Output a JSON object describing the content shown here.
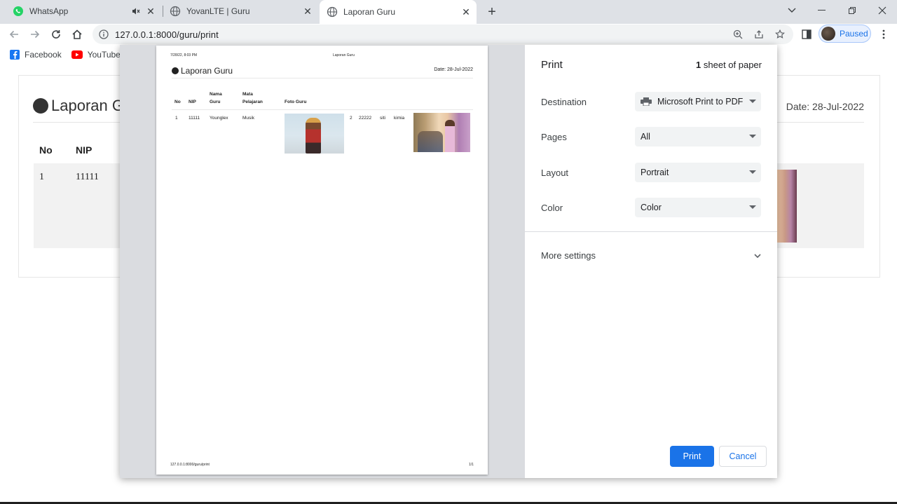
{
  "browser": {
    "tabs": [
      {
        "label": "WhatsApp",
        "icon": "whatsapp-icon"
      },
      {
        "label": "YovanLTE | Guru",
        "icon": "globe-icon"
      },
      {
        "label": "Laporan Guru",
        "icon": "globe-icon"
      }
    ],
    "url": "127.0.0.1:8000/guru/print",
    "profile_label": "Paused",
    "bookmarks": [
      {
        "label": "Facebook",
        "icon": "facebook-icon"
      },
      {
        "label": "YouTube",
        "icon": "youtube-icon"
      }
    ]
  },
  "background_page": {
    "title": "Laporan Gu",
    "date": "Date: 28-Jul-2022",
    "headers": [
      "No",
      "NIP"
    ],
    "row": [
      "1",
      "11111"
    ]
  },
  "print_preview": {
    "header_datetime": "7/28/22, 8:03 PM",
    "header_title": "Laporan Guru",
    "title": "Laporan Guru",
    "date": "Date: 28-Jul-2022",
    "columns": {
      "no": "No",
      "nip": "NIP",
      "nama_1": "Nama",
      "nama_2": "Guru",
      "mapel_1": "Mata",
      "mapel_2": "Pelajaran",
      "foto": "Foto Guru"
    },
    "rows": [
      {
        "no": "1",
        "nip": "11111",
        "nama": "Younglex",
        "mapel": "Musik"
      },
      {
        "no": "2",
        "nip": "22222",
        "nama": "siti",
        "mapel": "kimia"
      }
    ],
    "footer_url": "127.0.0.1:8000/guru/print",
    "footer_page": "1/1"
  },
  "print_settings": {
    "title": "Print",
    "sheets_count": "1",
    "sheets_suffix": " sheet of paper",
    "destination_label": "Destination",
    "destination_value": "Microsoft Print to PDF",
    "pages_label": "Pages",
    "pages_value": "All",
    "layout_label": "Layout",
    "layout_value": "Portrait",
    "color_label": "Color",
    "color_value": "Color",
    "more_settings": "More settings",
    "print_button": "Print",
    "cancel_button": "Cancel"
  },
  "colors": {
    "accent": "#1a73e8",
    "tabstrip": "#dee1e6"
  }
}
